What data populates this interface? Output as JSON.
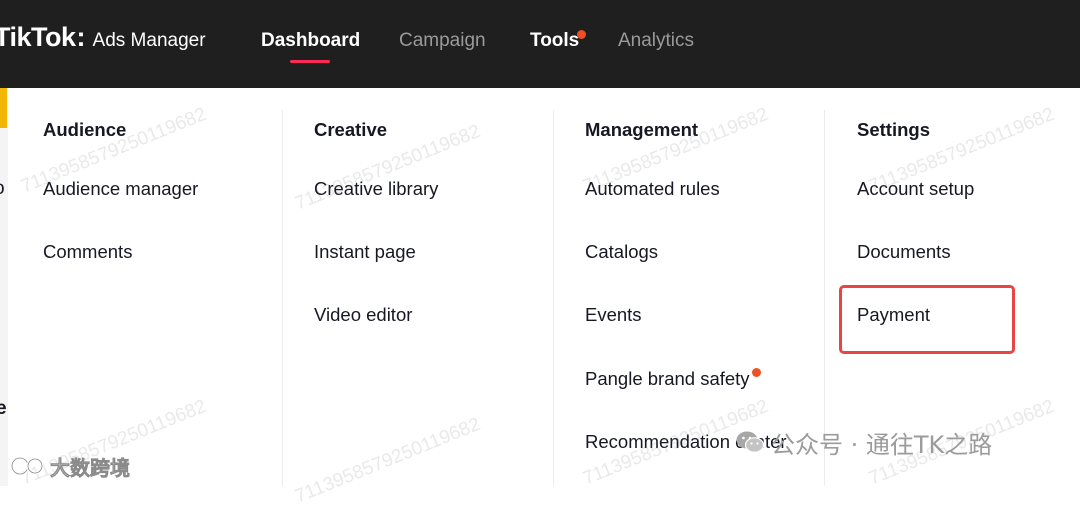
{
  "header": {
    "logo_brand": "TikTok",
    "logo_colon": ":",
    "logo_product": "Ads Manager",
    "nav": [
      {
        "label": "Dashboard"
      },
      {
        "label": "Campaign"
      },
      {
        "label": "Tools"
      },
      {
        "label": "Analytics"
      }
    ]
  },
  "page_fragments": [
    "o",
    "e"
  ],
  "menu": {
    "columns": [
      {
        "heading": "Audience",
        "items": [
          "Audience manager",
          "Comments"
        ]
      },
      {
        "heading": "Creative",
        "items": [
          "Creative library",
          "Instant page",
          "Video editor"
        ]
      },
      {
        "heading": "Management",
        "items": [
          "Automated rules",
          "Catalogs",
          "Events",
          "Pangle brand safety",
          "Recommendation center"
        ]
      },
      {
        "heading": "Settings",
        "items": [
          "Account setup",
          "Documents",
          "Payment"
        ]
      }
    ],
    "highlighted_item": "Payment"
  },
  "watermark": {
    "repeat_text": "7113958579250119682",
    "bottom_left": "大数跨境",
    "wechat": "公众号 · 通往TK之路"
  },
  "colors": {
    "topbar": "#1f1f1f",
    "accent_underline": "#fe2c55",
    "notification_dot": "#f04e23",
    "highlight_box": "#e84545"
  }
}
